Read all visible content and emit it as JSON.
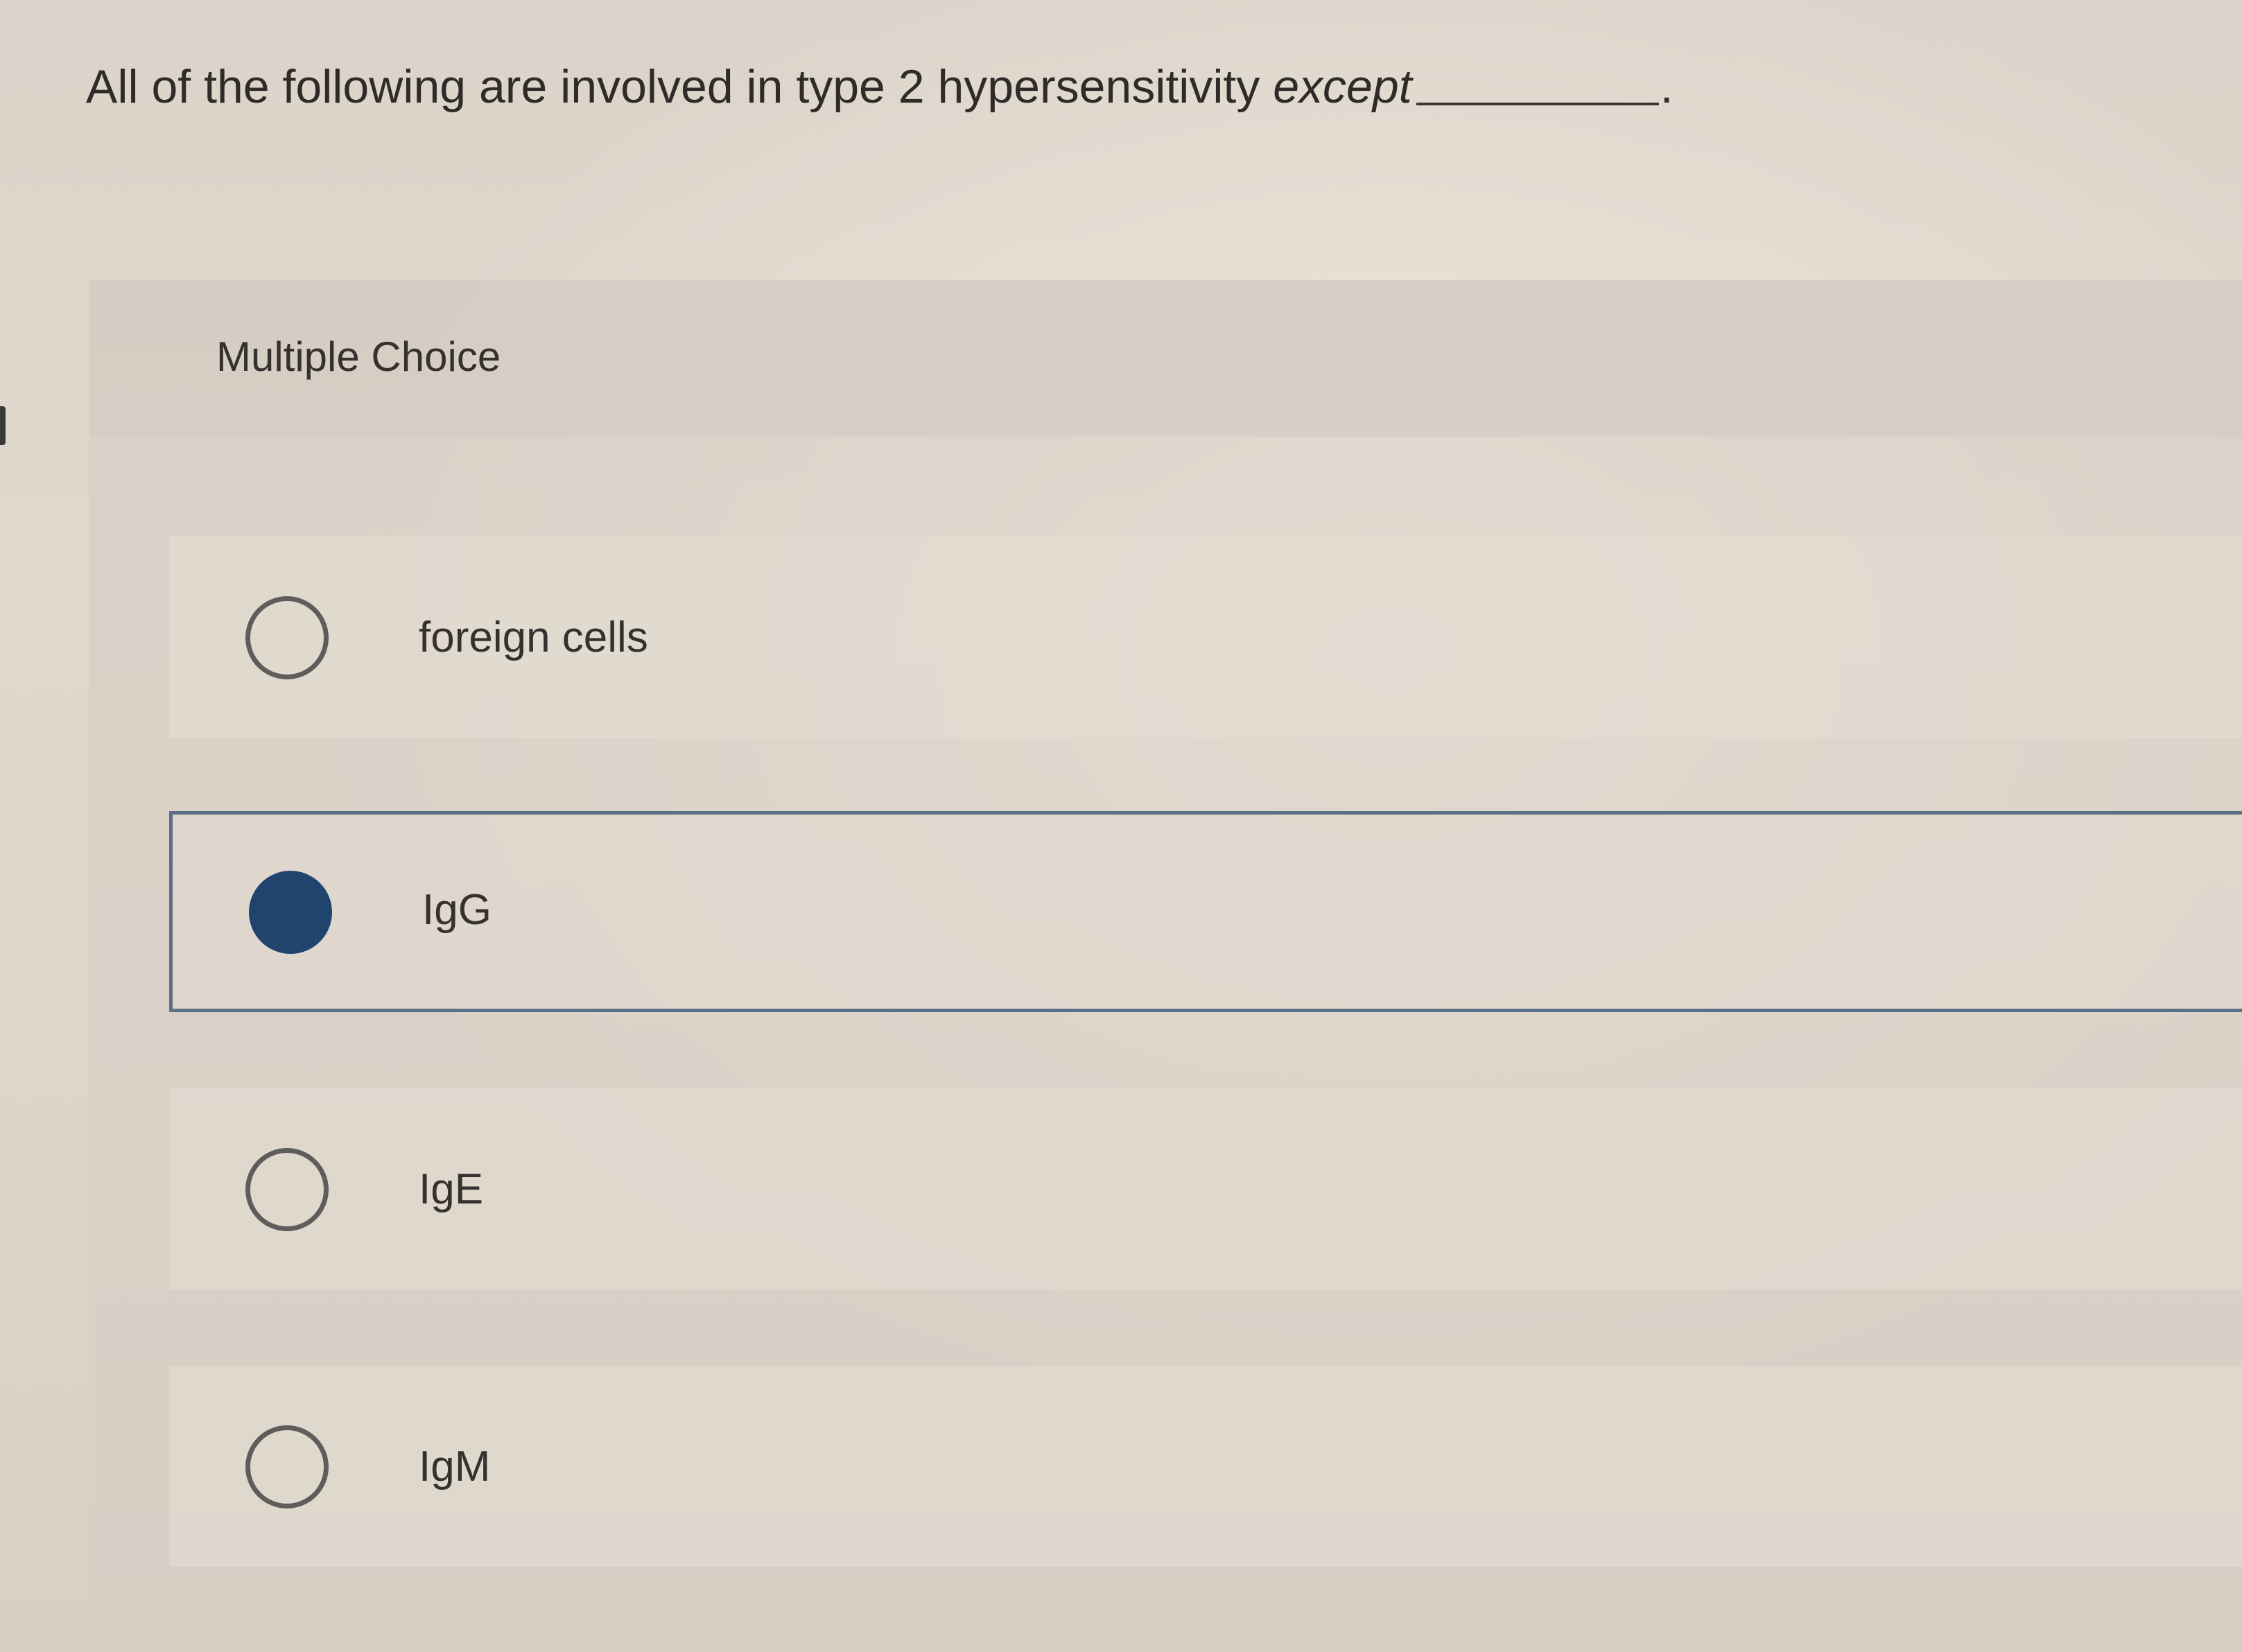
{
  "question": {
    "text": "All of the following are involved in type 2 hypersensitivity",
    "emphasis": "except",
    "blank_suffix": "."
  },
  "question_type": "Multiple Choice",
  "options": [
    {
      "label": "foreign cells",
      "selected": false
    },
    {
      "label": "IgG",
      "selected": true
    },
    {
      "label": "IgE",
      "selected": false
    },
    {
      "label": "IgM",
      "selected": false
    }
  ],
  "colors": {
    "selected_radio": "#21446e",
    "selected_border": "#5b6f86"
  }
}
